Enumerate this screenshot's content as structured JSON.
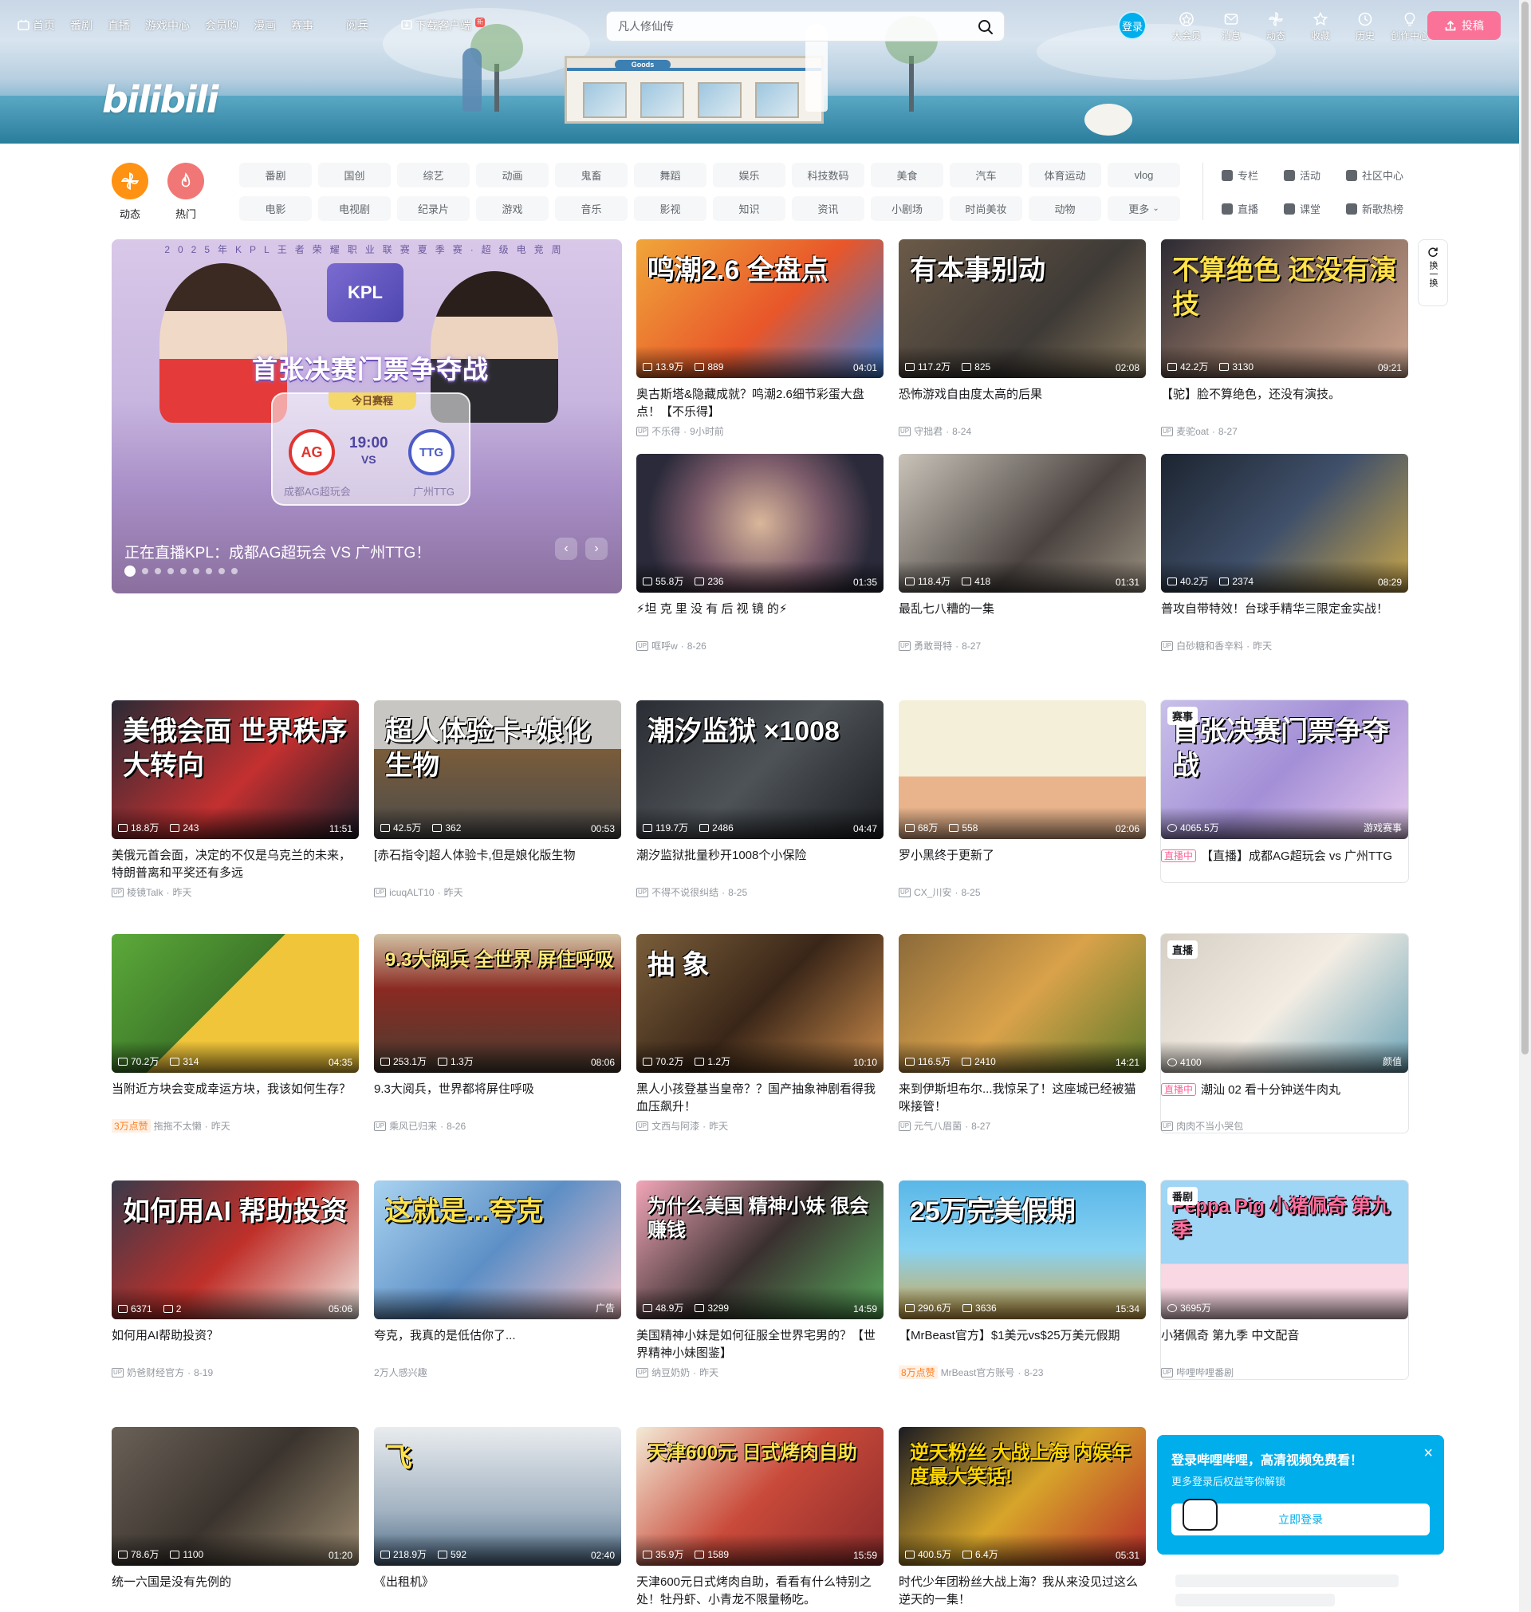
{
  "topnav": {
    "items": [
      "首页",
      "番剧",
      "直播",
      "游戏中心",
      "会员购",
      "漫画",
      "赛事",
      "阅兵",
      "下载客户端"
    ],
    "new_badge": "新"
  },
  "search": {
    "placeholder": "凡人修仙传"
  },
  "rightnav": {
    "login": "登录",
    "items": [
      "大会员",
      "消息",
      "动态",
      "收藏",
      "历史",
      "创作中心"
    ],
    "upload": "投稿"
  },
  "channels": {
    "dynamic": "动态",
    "hot": "热门",
    "grid": [
      "番剧",
      "国创",
      "综艺",
      "动画",
      "鬼畜",
      "舞蹈",
      "娱乐",
      "科技数码",
      "美食",
      "汽车",
      "体育运动",
      "vlog",
      "电影",
      "电视剧",
      "纪录片",
      "游戏",
      "音乐",
      "影视",
      "知识",
      "资讯",
      "小剧场",
      "时尚美妆",
      "动物",
      "更多"
    ],
    "extra": [
      "专栏",
      "活动",
      "社区中心",
      "直播",
      "课堂",
      "新歌热榜"
    ]
  },
  "carousel": {
    "top_strip": "2025年KPL王者荣耀职业联赛夏季赛·超级电竞周",
    "kpl": "KPL",
    "headline": "首张决赛门票争夺战",
    "today": "今日赛程",
    "time": "19:00",
    "vs": "VS",
    "team_a": "成都AG超玩会",
    "team_b": "广州TTG",
    "team_a_short": "AG",
    "team_b_short": "TTG",
    "caption": "正在直播KPL：成都AG超玩会 VS 广州TTG！",
    "prev": "‹",
    "next": "›"
  },
  "refresh": {
    "label": "换一换"
  },
  "cards": [
    {
      "views": "13.9万",
      "danmaku": "889",
      "duration": "04:01",
      "title": "奥古斯塔&隐藏成就？鸣潮2.6细节彩蛋大盘点！【不乐得】",
      "author": "不乐得",
      "date": "9小时前",
      "overlay": "鸣潮2.6 全盘点"
    },
    {
      "views": "117.2万",
      "danmaku": "825",
      "duration": "02:08",
      "title": "恐怖游戏自由度太高的后果",
      "author": "守拙君",
      "date": "8-24",
      "overlay": "有本事别动"
    },
    {
      "views": "42.2万",
      "danmaku": "3130",
      "duration": "09:21",
      "title": "【驼】脸不算绝色，还没有演技。",
      "author": "麦驼oat",
      "date": "8-27",
      "overlay": "不算绝色 还没有演技"
    },
    {
      "views": "55.8万",
      "danmaku": "236",
      "duration": "01:35",
      "title": "⚡坦 克 里 没 有 后 视 镜 的⚡",
      "author": "哐呼w",
      "date": "8-26",
      "overlay": ""
    },
    {
      "views": "118.4万",
      "danmaku": "418",
      "duration": "01:31",
      "title": "最乱七八糟的一集",
      "author": "勇敢哥特",
      "date": "8-27",
      "overlay": ""
    },
    {
      "views": "40.2万",
      "danmaku": "2374",
      "duration": "08:29",
      "title": "普攻自带特效！台球手精华三限定金实战！",
      "author": "白砂糖和香辛料",
      "date": "昨天",
      "overlay": ""
    },
    {
      "views": "18.8万",
      "danmaku": "243",
      "duration": "11:51",
      "title": "美俄元首会面，决定的不仅是乌克兰的未来，特朗普离和平奖还有多远",
      "author": "棱镜Talk",
      "date": "昨天",
      "overlay": "美俄会面 世界秩序大转向"
    },
    {
      "views": "42.5万",
      "danmaku": "362",
      "duration": "00:53",
      "title": "[赤石指令]超人体验卡,但是娘化版生物",
      "author": "icuqALT10",
      "date": "昨天",
      "overlay": "超人体验卡+娘化生物"
    },
    {
      "views": "119.7万",
      "danmaku": "2486",
      "duration": "04:47",
      "title": "潮汐监狱批量秒开1008个小保险",
      "author": "不得不说很纠结",
      "date": "8-25",
      "overlay": "潮汐监狱 ×1008"
    },
    {
      "views": "68万",
      "danmaku": "558",
      "duration": "02:06",
      "title": "罗小黑终于更新了",
      "author": "CX_川安",
      "date": "8-25",
      "overlay": ""
    },
    {
      "badge": "赛事",
      "live_views": "4065.5万",
      "area": "游戏赛事",
      "live_label": "直播中",
      "title": "【直播】成都AG超玩会 vs 广州TTG",
      "overlay": "首张决赛门票争夺战"
    },
    {
      "views": "70.2万",
      "danmaku": "314",
      "duration": "04:35",
      "title": "当附近方块会变成幸运方块，我该如何生存？",
      "author": "拖拖不太懒",
      "date": "昨天",
      "likes": "3万点赞",
      "overlay": ""
    },
    {
      "views": "253.1万",
      "danmaku": "1.3万",
      "duration": "08:06",
      "title": "9.3大阅兵，世界都将屏住呼吸",
      "author": "乘风已归来",
      "date": "8-26",
      "overlay": "9.3大阅兵 全世界 屏住呼吸"
    },
    {
      "views": "70.2万",
      "danmaku": "1.2万",
      "duration": "10:10",
      "title": "黑人小孩登基当皇帝？？国产抽象神剧看得我血压飙升！",
      "author": "文西与阿漆",
      "date": "昨天",
      "overlay": "抽 象"
    },
    {
      "views": "116.5万",
      "danmaku": "2410",
      "duration": "14:21",
      "title": "来到伊斯坦布尔...我惊呆了！这座城已经被猫咪接管！",
      "author": "元气八眉菌",
      "date": "8-27",
      "overlay": ""
    },
    {
      "badge": "直播",
      "live_views": "4100",
      "area": "颜值",
      "live_label": "直播中",
      "title": "潮汕 02 看十分钟送牛肉丸",
      "author": "肉肉不当小哭包",
      "overlay": ""
    },
    {
      "views": "6371",
      "danmaku": "2",
      "duration": "05:06",
      "title": "如何用AI帮助投资？",
      "author": "奶爸财经官方",
      "date": "8-19",
      "overlay": "如何用AI 帮助投资"
    },
    {
      "ad": "广告",
      "title": "夸克，我真的是低估你了...",
      "interest": "2万人感兴趣",
      "overlay": "这就是...夸克"
    },
    {
      "views": "48.9万",
      "danmaku": "3299",
      "duration": "14:59",
      "title": "美国精神小妹是如何征服全世界宅男的？【世界精神小妹图鉴】",
      "author": "纳豆奶奶",
      "date": "昨天",
      "overlay": "为什么美国 精神小妹 很会赚钱"
    },
    {
      "views": "290.6万",
      "danmaku": "3636",
      "duration": "15:34",
      "title": "【MrBeast官方】$1美元vs$25万美元假期",
      "author": "MrBeast官方账号",
      "date": "8-23",
      "likes": "8万点赞",
      "overlay": "25万完美假期"
    },
    {
      "badge": "番剧",
      "live_views": "3695万",
      "title": "小猪佩奇 第九季 中文配音",
      "author": "哔哩哔哩番剧",
      "overlay": "Peppa Pig 小猪佩奇 第九季"
    },
    {
      "views": "78.6万",
      "danmaku": "1100",
      "duration": "01:20",
      "title": "统一六国是没有先例的",
      "overlay": ""
    },
    {
      "views": "218.9万",
      "danmaku": "592",
      "duration": "02:40",
      "title": "《出租机》",
      "overlay": "飞"
    },
    {
      "views": "35.9万",
      "danmaku": "1589",
      "duration": "15:59",
      "title": "天津600元日式烤肉自助，看看有什么特别之处！牡丹虾、小青龙不限量畅吃。",
      "overlay": "天津600元 日式烤肉自助"
    },
    {
      "views": "400.5万",
      "danmaku": "6.4万",
      "duration": "05:31",
      "title": "时代少年团粉丝大战上海？我从来没见过这么逆天的一集！",
      "overlay": "逆天粉丝 大战上海 内娱年度最大笑话!"
    }
  ],
  "popup": {
    "title": "登录哔哩哔哩，高清视频免费看！",
    "subtitle": "更多登录后权益等你解锁",
    "button": "立即登录",
    "close": "×"
  },
  "logo": "bilibili",
  "colors": {
    "brand_pink": "#fb7299",
    "brand_blue": "#00aeec",
    "hot_red": "#fa5a57",
    "dynamic_orange": "#ff9212"
  }
}
